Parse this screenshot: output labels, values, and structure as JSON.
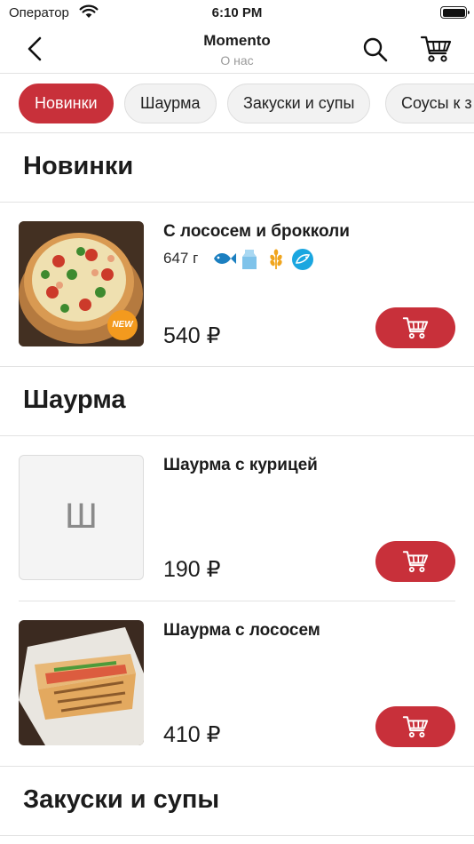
{
  "status_bar": {
    "carrier": "Оператор",
    "time": "6:10 PM"
  },
  "nav": {
    "title": "Momento",
    "subtitle": "О нас"
  },
  "categories": [
    "Новинки",
    "Шаурма",
    "Закуски и супы",
    "Соусы к з"
  ],
  "active_category": "Новинки",
  "sections": {
    "new": {
      "title": "Новинки",
      "product": {
        "name": "С лососем и брокколи",
        "weight": "647 г",
        "price": "540 ₽",
        "badge": "NEW",
        "allergens": [
          "fish-icon",
          "milk-icon",
          "wheat-icon",
          "seafood-icon"
        ]
      }
    },
    "shawarma": {
      "title": "Шаурма",
      "products": [
        {
          "name": "Шаурма с курицей",
          "price": "190 ₽",
          "placeholder": "Ш"
        },
        {
          "name": "Шаурма с лососем",
          "price": "410 ₽"
        }
      ]
    },
    "snacks": {
      "title": "Закуски и супы"
    }
  },
  "colors": {
    "accent": "#c8303a",
    "badge": "#f39a1e",
    "fish_icon": "#1b7fc0",
    "milk_icon": "#7fc3ea",
    "wheat_icon": "#f0a51e",
    "seafood_icon": "#1aa6e0"
  }
}
